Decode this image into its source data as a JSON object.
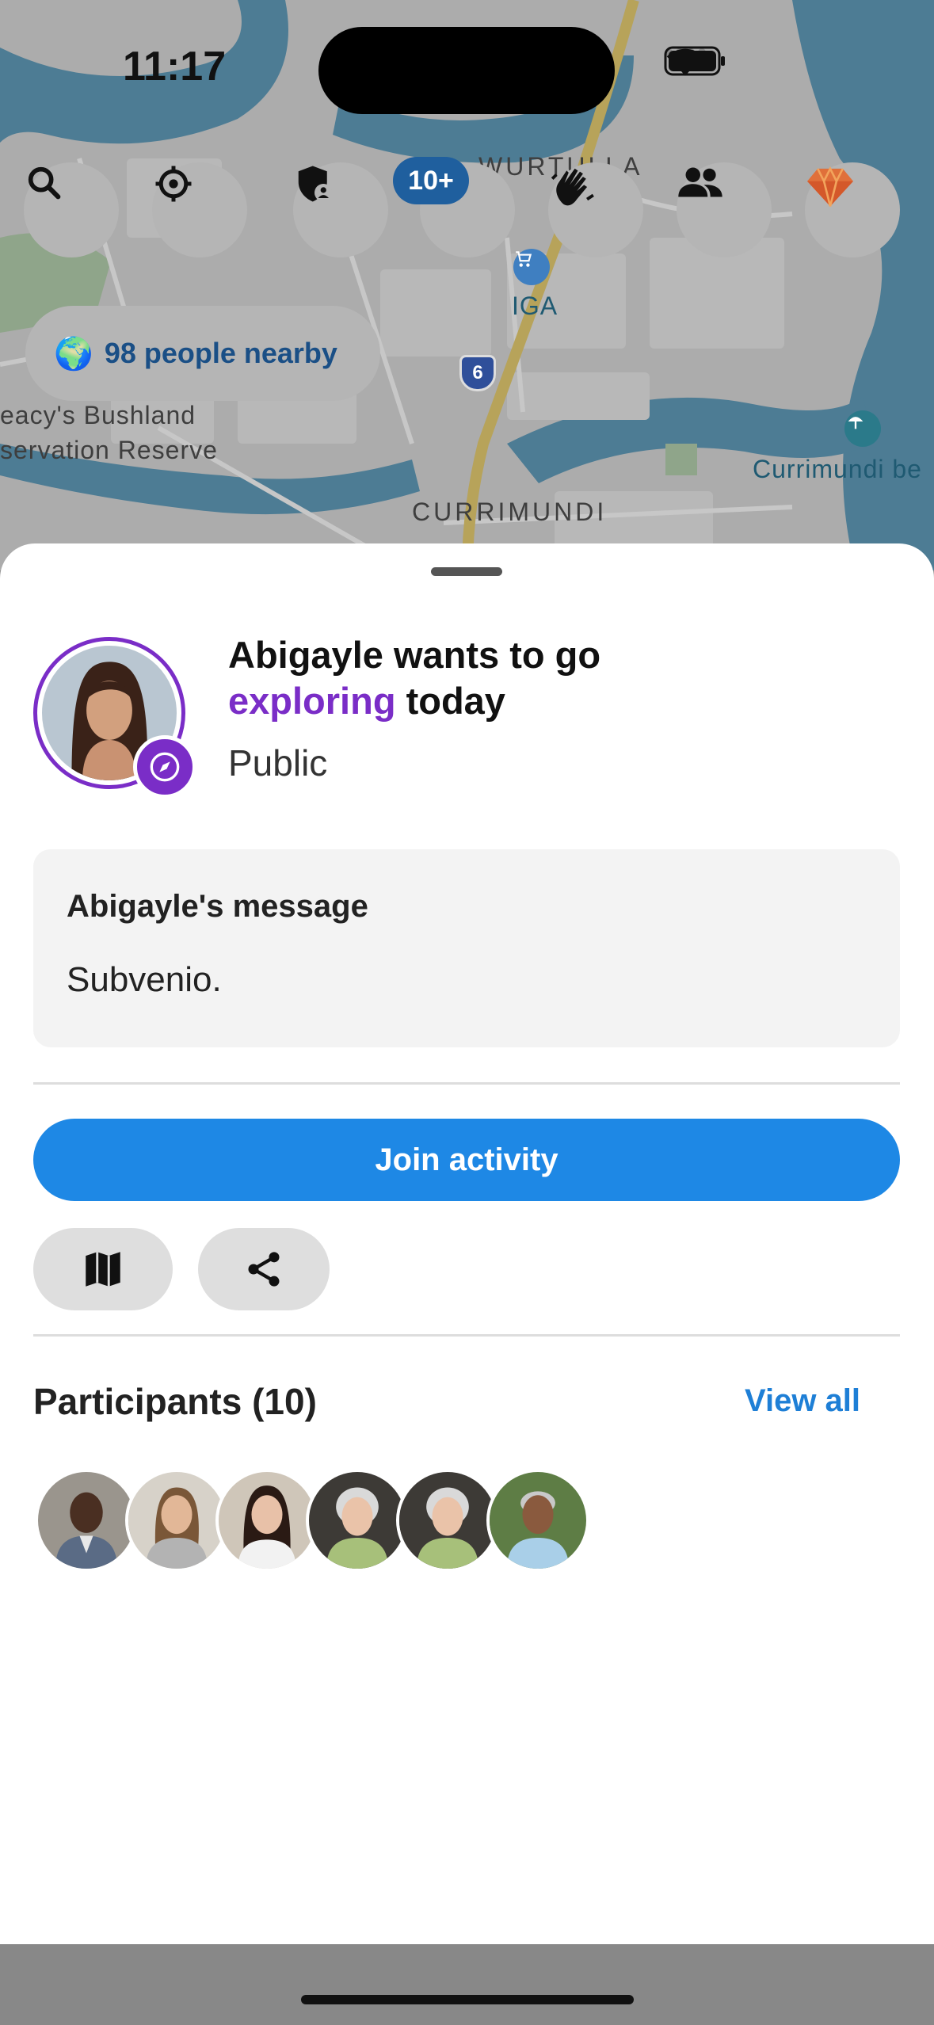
{
  "status_bar": {
    "time": "11:17"
  },
  "map": {
    "labels": {
      "suburb_1": "WURTULLA",
      "store": "IGA",
      "road": "6",
      "reserve_line1": "eacy's Bushland",
      "reserve_line2": "servation Reserve",
      "suburb_2": "CURRIMUNDI",
      "beach": "Currimundi be"
    },
    "toolbar_icons": [
      "search-icon",
      "locate-icon",
      "shield-user-icon",
      "bell-icon",
      "wave-icon",
      "people-icon",
      "gem-icon"
    ],
    "notification_badge": "10+",
    "nearby": {
      "emoji": "🌍",
      "label": "98 people nearby"
    }
  },
  "activity": {
    "headline_prefix": "Abigayle wants to go",
    "headline_accent": "exploring",
    "headline_suffix": "today",
    "visibility": "Public",
    "accent_color": "#7a2dc7",
    "message_title": "Abigayle's message",
    "message_body": "Subvenio.",
    "join_label": "Join activity",
    "join_color": "#1e88e5",
    "secondary_actions": [
      "map-icon",
      "share-icon"
    ]
  },
  "participants": {
    "title": "Participants (10)",
    "view_all": "View all",
    "shown_count": 6
  }
}
